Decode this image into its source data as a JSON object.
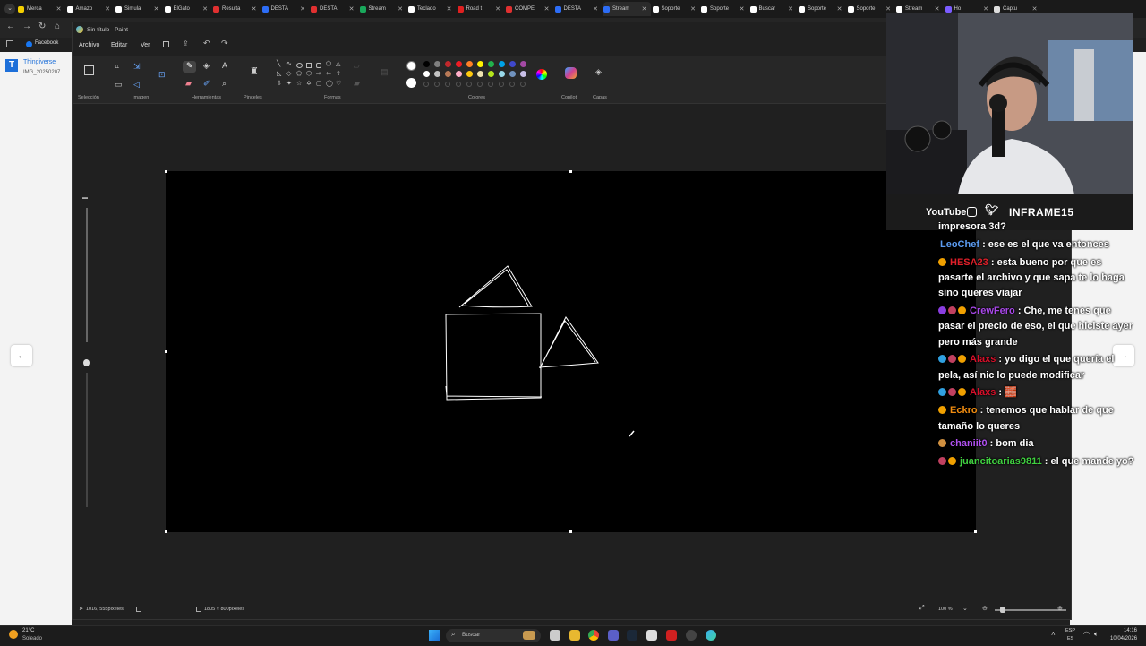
{
  "browser": {
    "tabs": [
      {
        "label": "Merca",
        "color": "#f5d000"
      },
      {
        "label": "Amazo",
        "color": "#ffffff"
      },
      {
        "label": "Simula",
        "color": "#ffffff"
      },
      {
        "label": "ElGato",
        "color": "#ffffff"
      },
      {
        "label": "Resulta",
        "color": "#e03030"
      },
      {
        "label": "DESTA",
        "color": "#2d6df6"
      },
      {
        "label": "DESTA",
        "color": "#e03030"
      },
      {
        "label": "Stream",
        "color": "#19a85b"
      },
      {
        "label": "Teclado",
        "color": "#ffffff"
      },
      {
        "label": "Road t",
        "color": "#e02020"
      },
      {
        "label": "COMPE",
        "color": "#e03030"
      },
      {
        "label": "DESTA",
        "color": "#2d6df6"
      },
      {
        "label": "Stream",
        "color": "#2d6df6"
      },
      {
        "label": "Soporte",
        "color": "#ffffff"
      },
      {
        "label": "Soporte",
        "color": "#ffffff"
      },
      {
        "label": "Buscar",
        "color": "#ffffff"
      },
      {
        "label": "Soporte",
        "color": "#ffffff"
      },
      {
        "label": "Soporte",
        "color": "#ffffff"
      },
      {
        "label": "Stream",
        "color": "#ffffff"
      },
      {
        "label": "Ho",
        "color": "#7b5cff"
      },
      {
        "label": "Captu",
        "color": "#dddddd"
      }
    ],
    "bookmark_facebook": "Facebook",
    "left_page_title": "Thingiverse",
    "left_page_sub": "IMG_20250207..."
  },
  "paint": {
    "window_title": "Sin título - Paint",
    "menu": [
      "Archivo",
      "Editar",
      "Ver"
    ],
    "groups": {
      "seleccion": "Selección",
      "imagen": "Imagen",
      "herramientas": "Herramientas",
      "pinceles": "Pinceles",
      "formas": "Formas",
      "colores": "Colores",
      "copilot": "Copilot",
      "capas": "Capas"
    },
    "palette_row1": [
      "#000000",
      "#7f7f7f",
      "#c0282c",
      "#ed1c24",
      "#ff7f27",
      "#fff200",
      "#22b14c",
      "#00a2e8",
      "#3f48cc",
      "#a349a4"
    ],
    "palette_row2": [
      "#ffffff",
      "#c3c3c3",
      "#b97a57",
      "#ffaec9",
      "#ffc90e",
      "#efe4b0",
      "#b5e61d",
      "#99d9ea",
      "#7092be",
      "#c8bfe7"
    ],
    "status": {
      "cursor_pos": "1016, 555píxeles",
      "canvas_size": "1805 × 800píxeles",
      "zoom": "100 %"
    }
  },
  "stream": {
    "socials_youtube": "YouTube",
    "channel_name": "INFRAME15"
  },
  "chat": [
    {
      "user": "",
      "user_color": "#ffffff",
      "message": "impresora 3d?",
      "badges": []
    },
    {
      "user": "LeoChef",
      "user_color": "#5b9bf0",
      "message": ": ese es el que va entonces",
      "badges": []
    },
    {
      "user": "HESA23",
      "user_color": "#e0202a",
      "message": ": esta bueno por que es pasarte el archivo y que sapa te lo haga sino queres viajar",
      "badges": [
        "#f0a000"
      ]
    },
    {
      "user": "CrewFero",
      "user_color": "#a848e8",
      "message": ": Che, me tenes que pasar el precio de eso, el que hiciste ayer pero más grande",
      "badges": [
        "#8a3de0",
        "#c04060",
        "#f0a000"
      ]
    },
    {
      "user": "Alaxs",
      "user_color": "#d8102a",
      "message": ": yo digo el que quería el pela, así nic lo puede modificar",
      "badges": [
        "#30a0e0",
        "#c04060",
        "#f0a000"
      ]
    },
    {
      "user": "Alaxs",
      "user_color": "#d8102a",
      "message": ": 🧱",
      "badges": [
        "#30a0e0",
        "#c04060",
        "#f0a000"
      ]
    },
    {
      "user": "Eckro",
      "user_color": "#f08c10",
      "message": ": tenemos que hablar de que tamaño lo queres",
      "badges": [
        "#f0a000"
      ]
    },
    {
      "user": "chaniit0",
      "user_color": "#b050f0",
      "message": ": bom dia",
      "badges": [
        "#d09040"
      ]
    },
    {
      "user": "juancitoarias9811",
      "user_color": "#40d040",
      "message": ": el que mande yo?",
      "badges": [
        "#c04060",
        "#f0a000"
      ]
    }
  ],
  "taskbar": {
    "weather_temp": "21°C",
    "weather_desc": "Soleado",
    "search_placeholder": "Buscar",
    "lang": "ESP",
    "lang_sub": "ES",
    "time": "14:16",
    "date": "10/04/2026"
  }
}
